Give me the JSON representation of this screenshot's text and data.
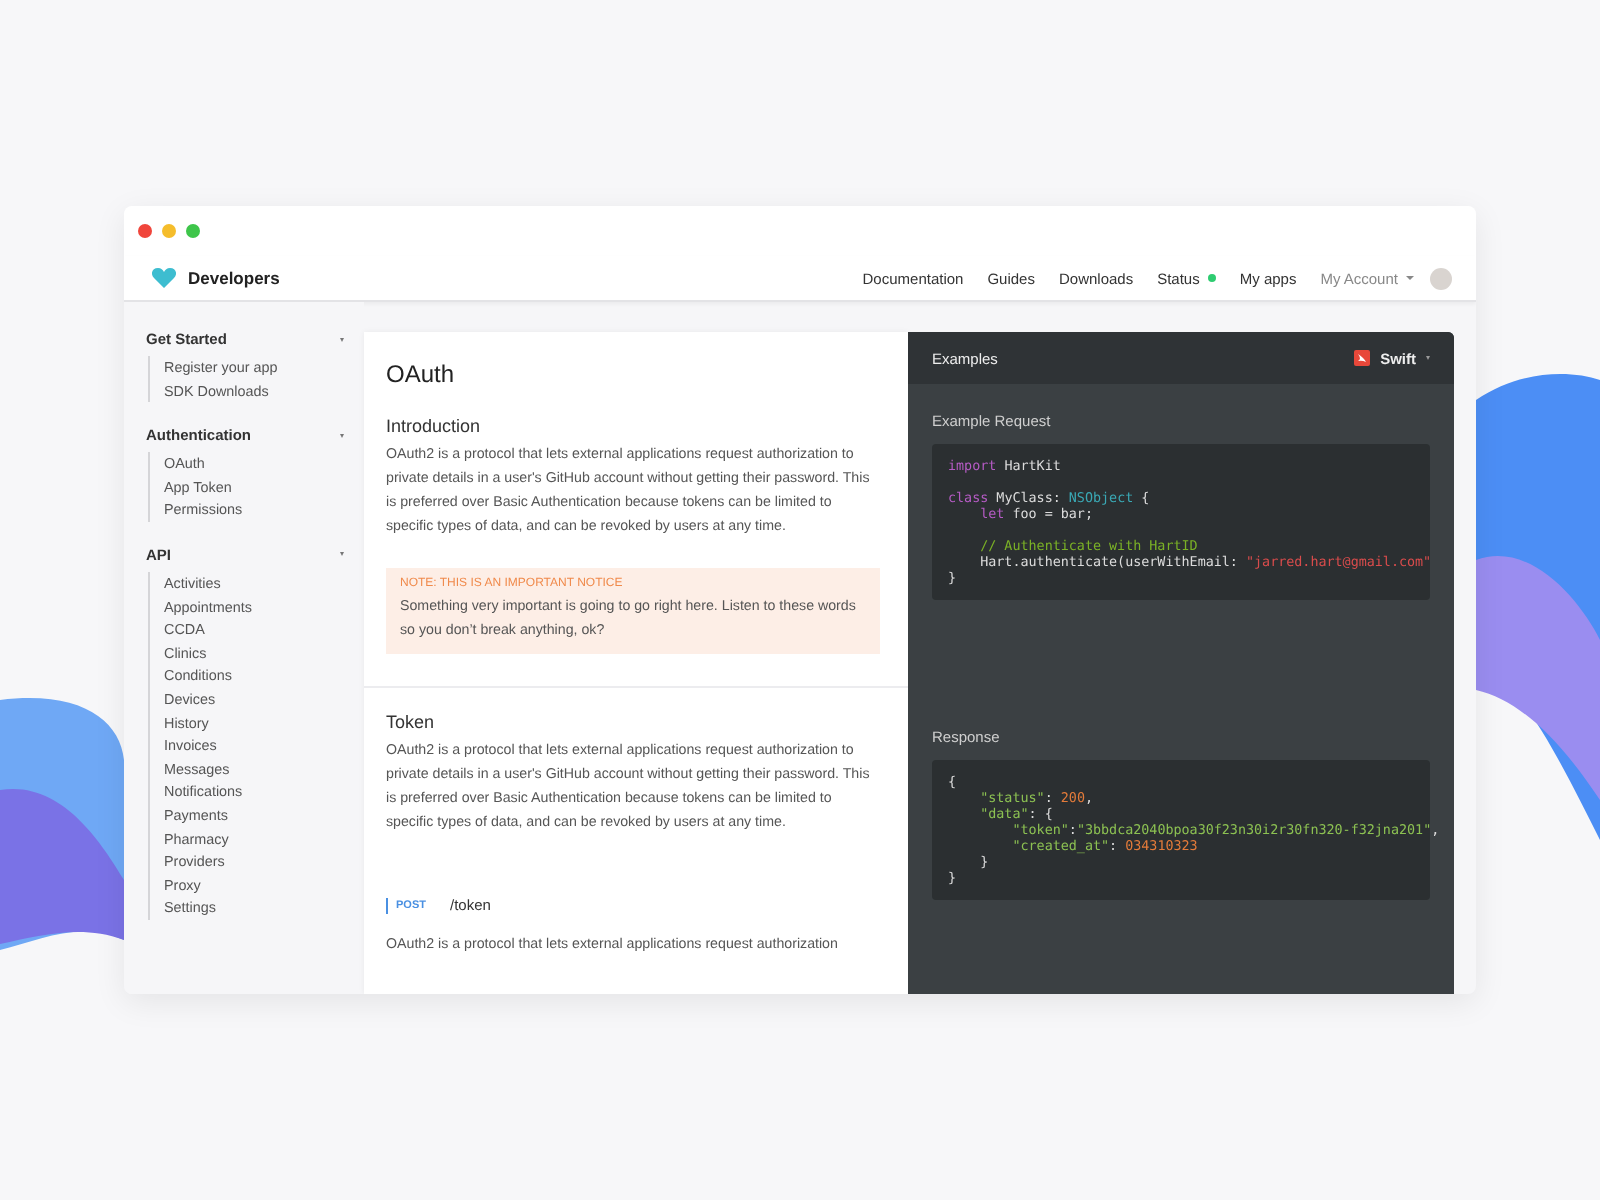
{
  "nav": {
    "brand": "Developers",
    "links": [
      {
        "label": "Documentation"
      },
      {
        "label": "Guides"
      },
      {
        "label": "Downloads"
      },
      {
        "label": "Status",
        "kind": "status"
      },
      {
        "label": "My apps"
      }
    ],
    "account": {
      "label": "My Account"
    }
  },
  "sidebar": {
    "sections": [
      {
        "title": "Get Started",
        "expanded": true,
        "items": [
          "Register your app",
          "SDK Downloads"
        ]
      },
      {
        "title": "Authentication",
        "expanded": true,
        "items": [
          "OAuth",
          "App Token",
          "Permissions"
        ]
      },
      {
        "title": "API",
        "expanded": true,
        "items": [
          "Activities",
          "Appointments",
          "CCDA",
          "Clinics",
          "Conditions",
          "Devices",
          "History",
          "Invoices",
          "Messages",
          "Notifications",
          "Payments",
          "Pharmacy",
          "Providers",
          "Proxy",
          "Settings"
        ]
      }
    ]
  },
  "doc": {
    "title": "OAuth",
    "sections": [
      {
        "heading": "Introduction",
        "paragraph": "OAuth2 is a protocol that lets external applications request authorization to private details in a user's GitHub account without getting their password. This is preferred over Basic Authentication because tokens can be limited to specific types of data, and can be revoked by users at any time.",
        "notice": {
          "label": "NOTE: THIS IS AN IMPORTANT NOTICE",
          "text": "Something very important is going to go right here. Listen to these words so you don’t break anything, ok?"
        }
      },
      {
        "heading": "Token",
        "paragraph": "OAuth2 is a protocol that lets external applications request authorization to private details in a user's GitHub account without getting their password. This is preferred over Basic Authentication because tokens can be limited to specific types of data, and can be revoked by users at any time.",
        "endpoint": {
          "method": "POST",
          "path": "/token"
        },
        "paragraph_after": "OAuth2 is a protocol that lets external applications request authorization"
      }
    ]
  },
  "examples": {
    "title": "Examples",
    "language": "Swift",
    "blocks": [
      {
        "label": "Example Request",
        "lines": [
          {
            "tokens": [
              {
                "kind": "keyword",
                "text": "import"
              },
              {
                "kind": "plain",
                "text": " HartKit"
              }
            ]
          },
          {
            "gap_before": true,
            "tokens": [
              {
                "kind": "keyword",
                "text": "class"
              },
              {
                "kind": "plain",
                "text": " MyClass: "
              },
              {
                "kind": "type",
                "text": "NSObject"
              },
              {
                "kind": "plain",
                "text": " {"
              }
            ]
          },
          {
            "tokens": [
              {
                "kind": "keyword",
                "text": "    let"
              },
              {
                "kind": "plain",
                "text": " foo = bar;"
              }
            ]
          },
          {
            "gap_before": true,
            "tokens": [
              {
                "kind": "comment",
                "text": "    // Authenticate with HartID"
              }
            ]
          },
          {
            "tokens": [
              {
                "kind": "plain",
                "text": "    Hart.authenticate(userWithEmail: "
              },
              {
                "kind": "string",
                "text": "\"jarred.hart@gmail.com\""
              }
            ]
          },
          {
            "tokens": [
              {
                "kind": "plain",
                "text": "}"
              }
            ]
          }
        ]
      },
      {
        "label": "Response",
        "lines": [
          {
            "tokens": [
              {
                "kind": "plain",
                "text": "{"
              }
            ]
          },
          {
            "tokens": [
              {
                "kind": "key",
                "text": "    \"status\""
              },
              {
                "kind": "plain",
                "text": ": "
              },
              {
                "kind": "number",
                "text": "200"
              },
              {
                "kind": "plain",
                "text": ","
              }
            ]
          },
          {
            "tokens": [
              {
                "kind": "key",
                "text": "    \"data\""
              },
              {
                "kind": "plain",
                "text": ": {"
              }
            ]
          },
          {
            "tokens": [
              {
                "kind": "key",
                "text": "        \"token\""
              },
              {
                "kind": "plain",
                "text": ":"
              },
              {
                "kind": "key",
                "text": "\"3bbdca2040bpoa30f23n30i2r30fn320-f32jna201\""
              },
              {
                "kind": "plain",
                "text": ","
              }
            ]
          },
          {
            "tokens": [
              {
                "kind": "key",
                "text": "        \"created_at\""
              },
              {
                "kind": "plain",
                "text": ": "
              },
              {
                "kind": "number",
                "text": "034310323"
              }
            ]
          },
          {
            "tokens": [
              {
                "kind": "plain",
                "text": "    }"
              }
            ]
          },
          {
            "tokens": [
              {
                "kind": "plain",
                "text": "}"
              }
            ]
          }
        ]
      }
    ]
  }
}
